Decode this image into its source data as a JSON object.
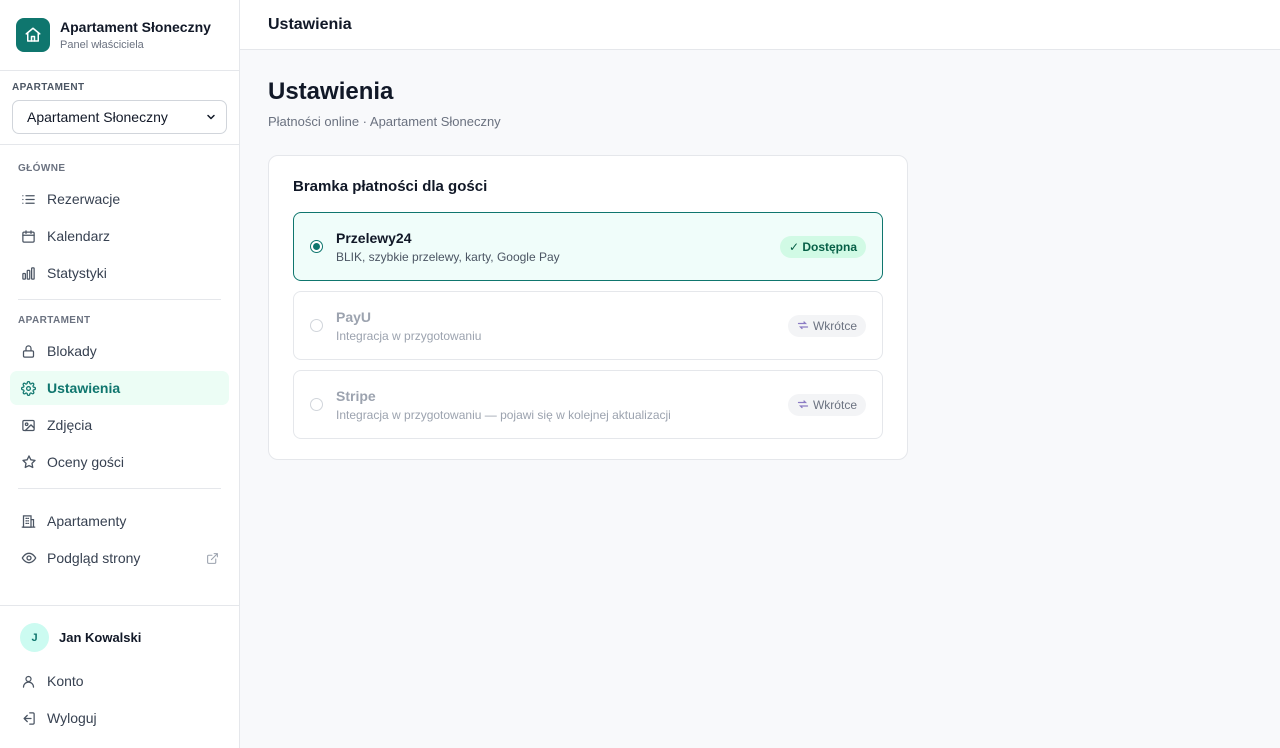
{
  "brand": {
    "title": "Apartament Słoneczny",
    "subtitle": "Panel właściciela"
  },
  "apartment_picker": {
    "label": "APARTAMENT",
    "selected": "Apartament Słoneczny"
  },
  "nav": {
    "section_main": "GŁÓWNE",
    "section_apartment": "APARTAMENT",
    "rezerwacje": "Rezerwacje",
    "kalendarz": "Kalendarz",
    "statystyki": "Statystyki",
    "blokady": "Blokady",
    "ustawienia": "Ustawienia",
    "zdjecia": "Zdjęcia",
    "oceny": "Oceny gości",
    "apartamenty": "Apartamenty",
    "podglad": "Podgląd strony"
  },
  "user": {
    "initial": "J",
    "name": "Jan Kowalski",
    "account": "Konto",
    "logout": "Wyloguj"
  },
  "topbar": {
    "title": "Ustawienia"
  },
  "page": {
    "title": "Ustawienia",
    "subtitle": "Płatności online · Apartament Słoneczny"
  },
  "gateway": {
    "title": "Bramka płatności dla gości",
    "options": [
      {
        "name": "Przelewy24",
        "desc": "BLIK, szybkie przelewy, karty, Google Pay",
        "badge": "✓ Dostępna",
        "selected": true
      },
      {
        "name": "PayU",
        "desc": "Integracja w przygotowaniu",
        "badge": "Wkrótce",
        "selected": false
      },
      {
        "name": "Stripe",
        "desc": "Integracja w przygotowaniu — pojawi się w kolejnej aktualizacji",
        "badge": "Wkrótce",
        "selected": false
      }
    ]
  },
  "colors": {
    "accent": "#0f766e",
    "accent_bg": "#ecfdf5",
    "badge_ok_bg": "#d1fae5"
  }
}
